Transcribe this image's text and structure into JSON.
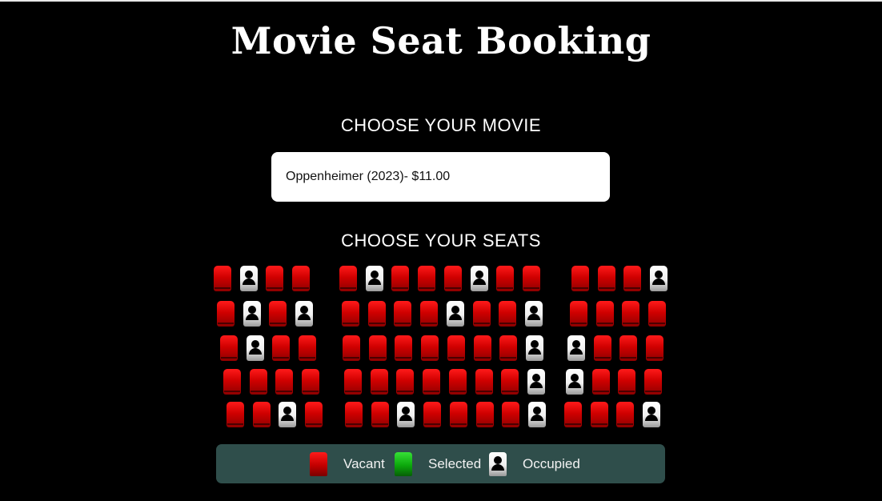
{
  "page": {
    "title": "Movie Seat Booking"
  },
  "movie": {
    "section_label": "CHOOSE YOUR MOVIE",
    "selected_option": "Oppenheimer (2023)- $11.00"
  },
  "seats": {
    "section_label": "CHOOSE YOUR SEATS",
    "rows": [
      {
        "left": [
          "vacant",
          "occupied",
          "vacant",
          "vacant"
        ],
        "middle": [
          "vacant",
          "occupied",
          "vacant",
          "vacant",
          "vacant",
          "occupied",
          "vacant",
          "vacant"
        ],
        "right": [
          "vacant",
          "vacant",
          "vacant",
          "occupied"
        ]
      },
      {
        "left": [
          "vacant",
          "occupied",
          "vacant",
          "occupied"
        ],
        "middle": [
          "vacant",
          "vacant",
          "vacant",
          "vacant",
          "occupied",
          "vacant",
          "vacant",
          "occupied"
        ],
        "right": [
          "vacant",
          "vacant",
          "vacant",
          "vacant"
        ]
      },
      {
        "left": [
          "vacant",
          "occupied",
          "vacant",
          "vacant"
        ],
        "middle": [
          "vacant",
          "vacant",
          "vacant",
          "vacant",
          "vacant",
          "vacant",
          "vacant",
          "occupied"
        ],
        "right": [
          "occupied",
          "vacant",
          "vacant",
          "vacant"
        ]
      },
      {
        "left": [
          "vacant",
          "vacant",
          "vacant",
          "vacant"
        ],
        "middle": [
          "vacant",
          "vacant",
          "vacant",
          "vacant",
          "vacant",
          "vacant",
          "vacant",
          "occupied"
        ],
        "right": [
          "occupied",
          "vacant",
          "vacant",
          "vacant"
        ]
      },
      {
        "left": [
          "vacant",
          "vacant",
          "occupied",
          "vacant"
        ],
        "middle": [
          "vacant",
          "vacant",
          "occupied",
          "vacant",
          "vacant",
          "vacant",
          "vacant",
          "occupied"
        ],
        "right": [
          "vacant",
          "vacant",
          "vacant",
          "occupied"
        ]
      }
    ]
  },
  "legend": {
    "vacant_label": "Vacant",
    "selected_label": "Selected",
    "occupied_label": "Occupied",
    "vacant_icon": "vacant-seat-icon",
    "selected_icon": "selected-seat-icon",
    "occupied_icon": "occupied-seat-icon"
  },
  "colors": {
    "background": "#000000",
    "vacant": "#d00000",
    "selected": "#0ca80c",
    "occupied": "#f0f0f0",
    "legend_bg": "#2f4e4b"
  }
}
